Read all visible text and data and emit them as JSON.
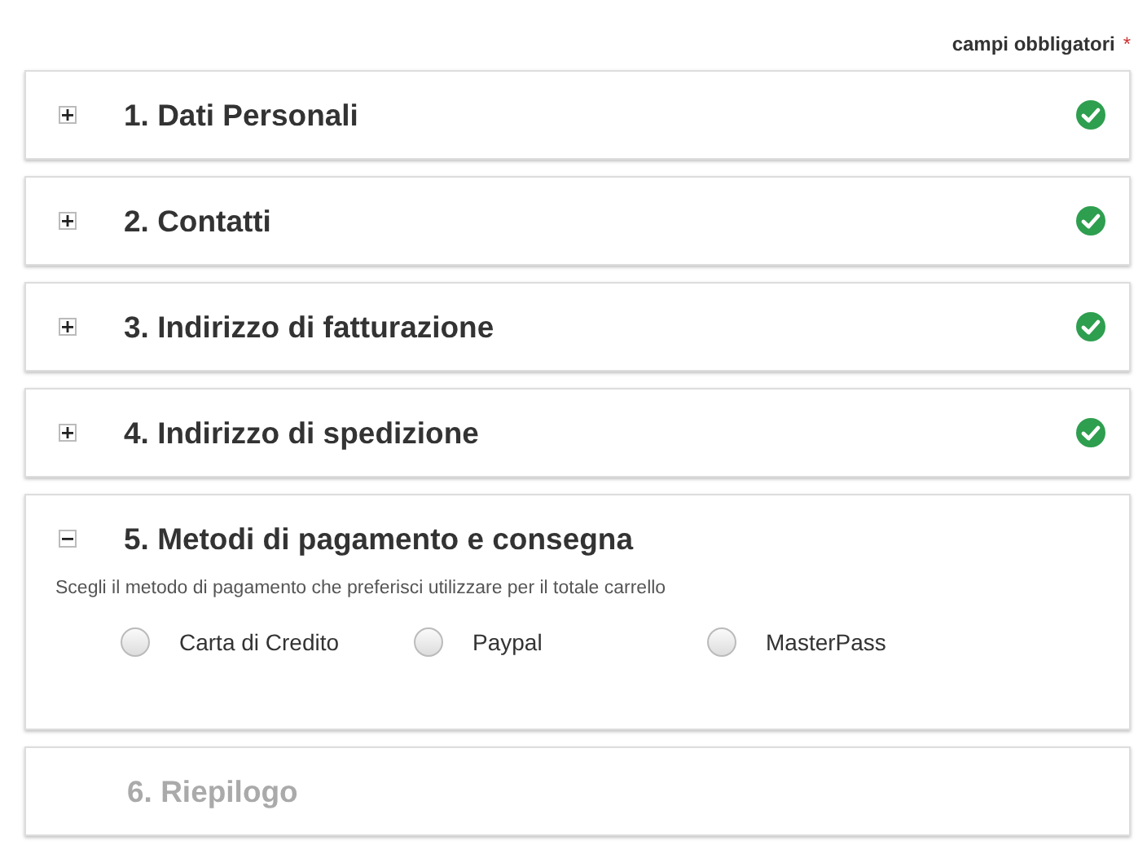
{
  "required_note": {
    "label": "campi obbligatori",
    "marker": "*"
  },
  "sections": [
    {
      "title": "1. Dati Personali",
      "expanded": false,
      "complete": true,
      "disabled": false
    },
    {
      "title": "2. Contatti",
      "expanded": false,
      "complete": true,
      "disabled": false
    },
    {
      "title": "3. Indirizzo di fatturazione",
      "expanded": false,
      "complete": true,
      "disabled": false
    },
    {
      "title": "4. Indirizzo di spedizione",
      "expanded": false,
      "complete": true,
      "disabled": false
    },
    {
      "title": "5. Metodi di pagamento e consegna",
      "expanded": true,
      "complete": false,
      "disabled": false,
      "description": "Scegli il metodo di pagamento che preferisci utilizzare per il totale carrello",
      "options": [
        {
          "label": "Carta di Credito",
          "selected": false
        },
        {
          "label": "Paypal",
          "selected": false
        },
        {
          "label": "MasterPass",
          "selected": false
        }
      ]
    },
    {
      "title": "6. Riepilogo",
      "expanded": false,
      "complete": false,
      "disabled": true
    }
  ]
}
